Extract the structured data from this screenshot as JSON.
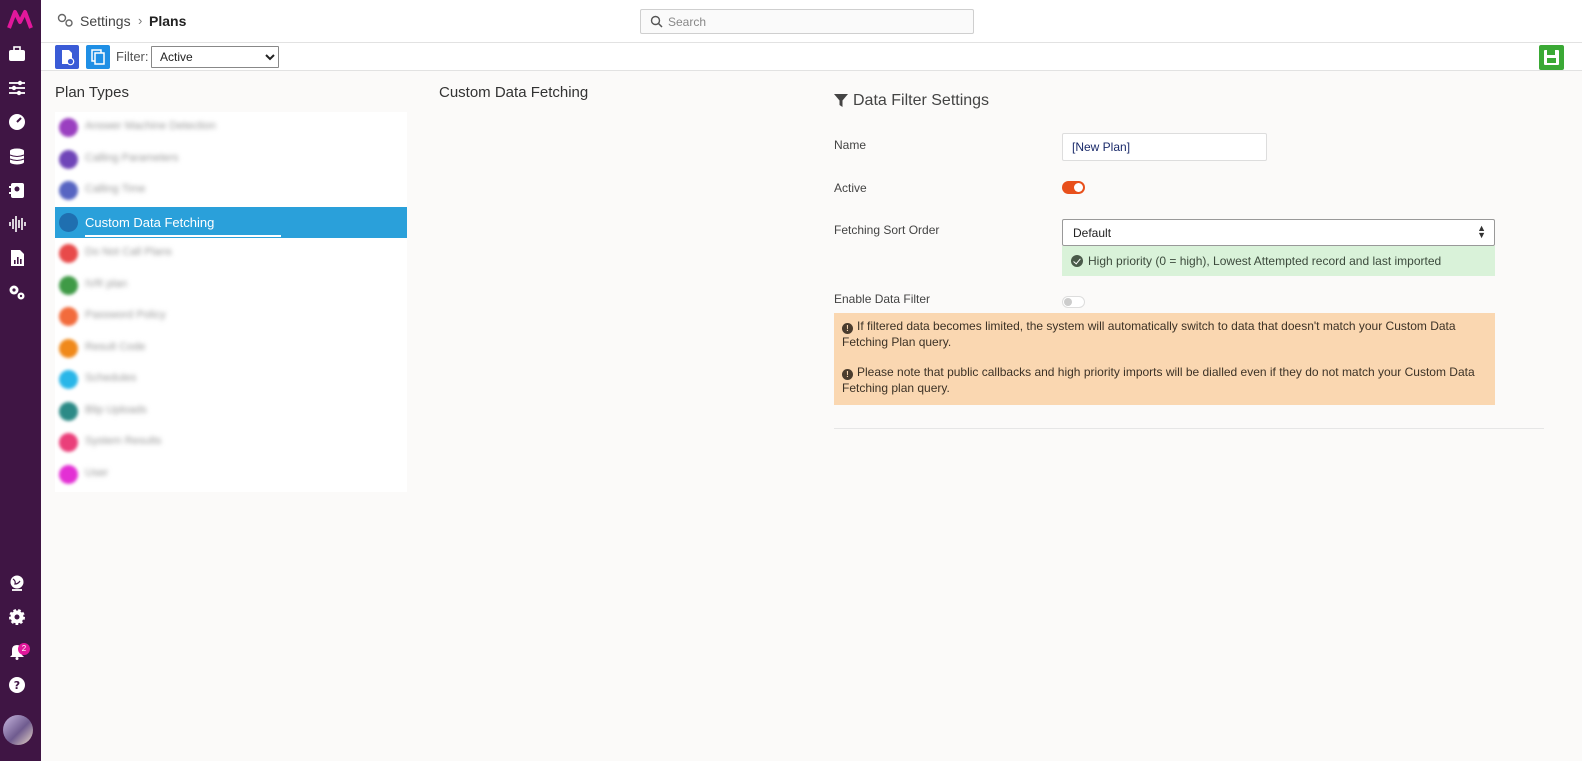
{
  "breadcrumb": {
    "parent": "Settings",
    "separator": "›",
    "current": "Plans"
  },
  "search": {
    "placeholder": "Search"
  },
  "toolbar": {
    "filter_label": "Filter:",
    "filter_value": "Active",
    "new_plan_icon": "new-document-icon",
    "copy_plan_icon": "copy-icon",
    "save_icon": "save-floppy-icon",
    "save_color": "#3aa935"
  },
  "sidebar": {
    "logo": "M",
    "icons": [
      "briefcase-icon",
      "sliders-icon",
      "dashboard-gauge-icon",
      "database-icon",
      "contacts-icon",
      "audio-wave-icon",
      "report-icon",
      "cogs-icon",
      "globe-icon",
      "settings-gear-icon",
      "bell-icon",
      "help-icon"
    ],
    "notification_count": "2",
    "background": "#3f1544"
  },
  "plan_types": {
    "title": "Plan Types",
    "items": [
      {
        "label": "Answer Machine Detection",
        "color": "#9a3fc0",
        "selected": false
      },
      {
        "label": "Calling Parameters",
        "color": "#6f45b8",
        "selected": false
      },
      {
        "label": "Calling Time",
        "color": "#5765c2",
        "selected": false
      },
      {
        "label": "Custom Data Fetching",
        "color": "#1f6fb0",
        "selected": true
      },
      {
        "label": "Do Not Call Plans",
        "color": "#e84a4a",
        "selected": false
      },
      {
        "label": "IVR plan",
        "color": "#3f9a46",
        "selected": false
      },
      {
        "label": "Password Policy",
        "color": "#f26b3c",
        "selected": false
      },
      {
        "label": "Result Code",
        "color": "#f0891a",
        "selected": false
      },
      {
        "label": "Schedules",
        "color": "#29b6e8",
        "selected": false
      },
      {
        "label": "Blip Uploads",
        "color": "#2b8a86",
        "selected": false
      },
      {
        "label": "System Results",
        "color": "#ea3f7a",
        "selected": false
      },
      {
        "label": "User",
        "color": "#e32fd4",
        "selected": false
      }
    ]
  },
  "middle": {
    "title": "Custom Data Fetching"
  },
  "data_filter_settings": {
    "title": "Data Filter Settings",
    "name_label": "Name",
    "name_value": "[New Plan]",
    "active_label": "Active",
    "active_on": true,
    "sort_label": "Fetching Sort Order",
    "sort_value": "Default",
    "sort_info": "High priority (0 = high), Lowest Attempted record and last imported",
    "enable_label": "Enable Data Filter",
    "enable_on": false,
    "warning_1": "If filtered data becomes limited, the system will automatically switch to data that doesn't match your Custom Data Fetching Plan query.",
    "warning_2": "Please note that public callbacks and high priority imports will be dialled even if they do not match your Custom Data Fetching plan query."
  }
}
